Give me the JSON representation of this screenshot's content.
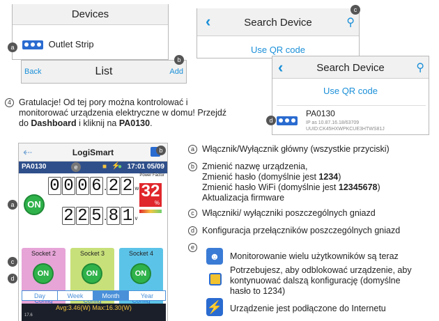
{
  "screen_devices": {
    "title": "Devices",
    "item": "Outlet Strip",
    "marker": "a"
  },
  "screen_list": {
    "back": "Back",
    "title": "List",
    "add": "Add",
    "marker": "b"
  },
  "screen_search1": {
    "title": "Search Device",
    "qr": "Use QR code",
    "marker": "c"
  },
  "screen_search2": {
    "title": "Search Device",
    "qr": "Use QR code",
    "device": "PA0130",
    "ip": "IP as 10.87.16.18/63709",
    "uuid": "UUID:CK45HXWPKCUE3HTWS81J",
    "marker": "d"
  },
  "step": {
    "number": "4",
    "line1": "Gratulacje! Od tej pory można kontrolować i",
    "line2": "monitorować urządzenia elektryczne w domu! Przejdź",
    "line3_pre": "do ",
    "line3_b1": "Dashboard",
    "line3_mid": " i kliknij na ",
    "line3_b2": "PA0130",
    "line3_post": "."
  },
  "dashboard": {
    "app_title": "LogiSmart",
    "device": "PA0130",
    "time": "17:01 05/09",
    "marker_e": "e",
    "marker_b": "b",
    "marker_a": "a",
    "marker_c": "c",
    "marker_d": "d",
    "power_digits": "0006",
    "power_dec": "22",
    "power_unit": "w",
    "volt_digits": "225",
    "volt_dec": "81",
    "volt_unit": "v",
    "pf_label": "Power Factor",
    "pf_value": "32",
    "pf_unit": "%",
    "on": "ON",
    "sockets": [
      {
        "label": "Socket 2",
        "on": "ON",
        "config": "Config",
        "color": "#e6a4d7"
      },
      {
        "label": "Socket 3",
        "on": "ON",
        "config": "Config",
        "color": "#c8e07a"
      },
      {
        "label": "Socket 4",
        "on": "ON",
        "config": "Config",
        "color": "#5cc3e8"
      }
    ],
    "tabs": [
      "Day",
      "Week",
      "Month",
      "Year"
    ],
    "active_tab": "Month",
    "chart_info": "Avg:3.46(W)  Max:16.30(W)",
    "chart_y": "17.6"
  },
  "legend": {
    "a": {
      "marker": "a",
      "text": "Włącznik/Wyłącznik główny (wszystkie przyciski)"
    },
    "b": {
      "marker": "b",
      "l1": "Zmienić nazwę urządzenia,",
      "l2_pre": "Zmienić hasło (domyślnie jest ",
      "l2_b": "1234",
      "l2_post": ")",
      "l3_pre": "Zmienić hasło WiFi (domyślnie jest ",
      "l3_b": "12345678",
      "l3_post": ")",
      "l4": "Aktualizacja firmware"
    },
    "c": {
      "marker": "c",
      "text": "Włączniki/ wyłączniki poszczególnych gniazd"
    },
    "d": {
      "marker": "d",
      "text": "Konfiguracja przełączników poszczególnych gniazd"
    },
    "e": {
      "marker": "e",
      "t1": "Monitorowanie wielu użytkowników są teraz",
      "t2a": "Potrzebujesz, aby odblokować urządzenie, aby",
      "t2b": "kontynuować dalszą konfigurację (domyślne",
      "t2c": "hasło to 1234)",
      "t3": "Urządzenie jest podłączone do Internetu"
    }
  }
}
